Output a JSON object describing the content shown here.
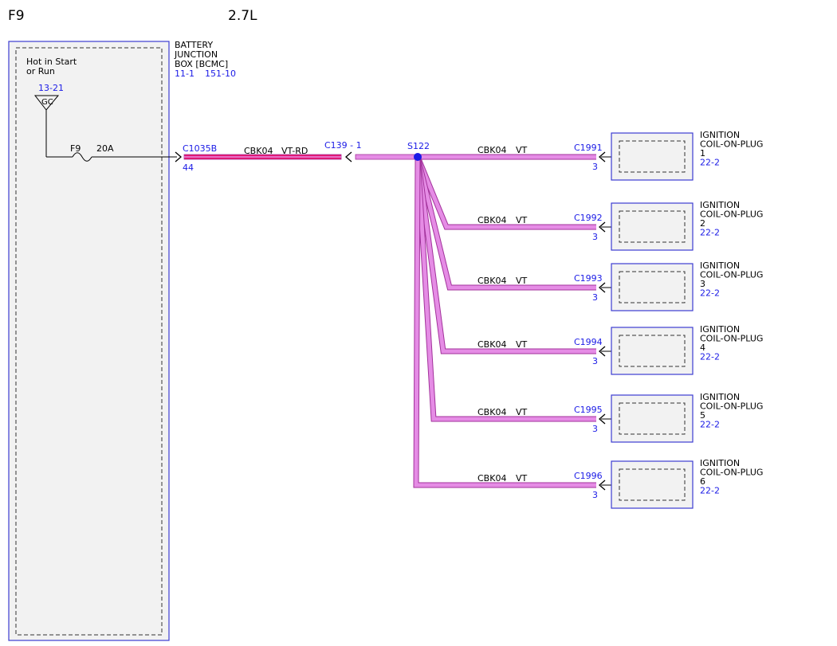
{
  "header": {
    "fuse_id": "F9",
    "engine": "2.7L"
  },
  "module": {
    "name_lines": [
      "BATTERY",
      "JUNCTION",
      "BOX [BCMC]"
    ],
    "refs": [
      "11-1",
      "151-10"
    ],
    "power_label_lines": [
      "Hot in Start",
      "or Run"
    ],
    "power_ref": "13-21",
    "ground_label": "GC",
    "fuse_label": "F9",
    "fuse_rating": "20A"
  },
  "main_wire": {
    "connector": "C1035B",
    "pin": "44",
    "circuit": "CBK04",
    "color": "VT-RD",
    "inline_connector": "C139 - 1"
  },
  "splice": {
    "label": "S122"
  },
  "branches": [
    {
      "circuit": "CBK04",
      "color": "VT",
      "connector": "C1991",
      "pin": "3",
      "device_lines": [
        "IGNITION",
        "COIL-ON-PLUG",
        "1"
      ],
      "device_ref": "22-2"
    },
    {
      "circuit": "CBK04",
      "color": "VT",
      "connector": "C1992",
      "pin": "3",
      "device_lines": [
        "IGNITION",
        "COIL-ON-PLUG",
        "2"
      ],
      "device_ref": "22-2"
    },
    {
      "circuit": "CBK04",
      "color": "VT",
      "connector": "C1993",
      "pin": "3",
      "device_lines": [
        "IGNITION",
        "COIL-ON-PLUG",
        "3"
      ],
      "device_ref": "22-2"
    },
    {
      "circuit": "CBK04",
      "color": "VT",
      "connector": "C1994",
      "pin": "3",
      "device_lines": [
        "IGNITION",
        "COIL-ON-PLUG",
        "4"
      ],
      "device_ref": "22-2"
    },
    {
      "circuit": "CBK04",
      "color": "VT",
      "connector": "C1995",
      "pin": "3",
      "device_lines": [
        "IGNITION",
        "COIL-ON-PLUG",
        "5"
      ],
      "device_ref": "22-2"
    },
    {
      "circuit": "CBK04",
      "color": "VT",
      "connector": "C1996",
      "pin": "3",
      "device_lines": [
        "IGNITION",
        "COIL-ON-PLUG",
        "6"
      ],
      "device_ref": "22-2"
    }
  ],
  "colors": {
    "wire_violet": "#e58ce5",
    "wire_red": "#e8146e",
    "wire_outline": "#a2329b",
    "ref_blue": "#1a1ae6",
    "box_border": "#3c3cd2",
    "box_fill": "#f2f2f2"
  }
}
